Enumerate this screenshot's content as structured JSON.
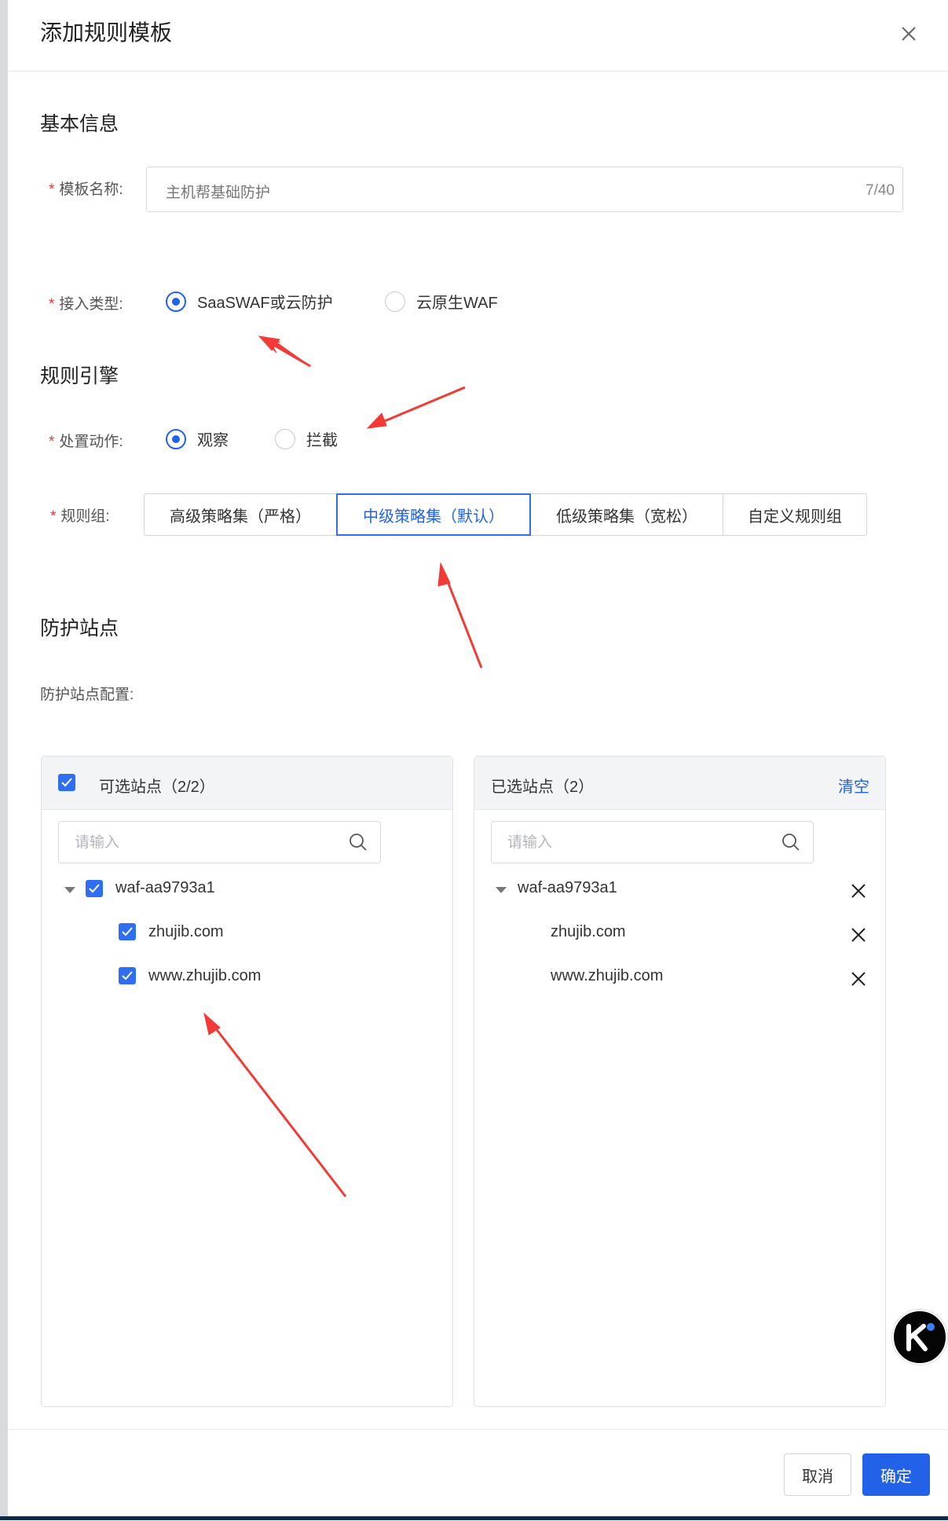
{
  "drawer": {
    "title": "添加规则模板"
  },
  "basic_info": {
    "section_title": "基本信息",
    "template_name": {
      "label": "模板名称:",
      "value": "主机帮基础防护",
      "counter": "7/40"
    },
    "access_type": {
      "label": "接入类型:",
      "options": [
        {
          "label": "SaaSWAF或云防护",
          "selected": true
        },
        {
          "label": "云原生WAF",
          "selected": false
        }
      ]
    }
  },
  "rule_engine": {
    "section_title": "规则引擎",
    "action": {
      "label": "处置动作:",
      "options": [
        {
          "label": "观察",
          "selected": true
        },
        {
          "label": "拦截",
          "selected": false
        }
      ]
    },
    "rule_group": {
      "label": "规则组:",
      "options": [
        {
          "label": "高级策略集（严格）",
          "selected": false
        },
        {
          "label": "中级策略集（默认）",
          "selected": true
        },
        {
          "label": "低级策略集（宽松）",
          "selected": false
        },
        {
          "label": "自定义规则组",
          "selected": false
        }
      ]
    }
  },
  "protect_sites": {
    "section_title": "防护站点",
    "config_label": "防护站点配置:",
    "available": {
      "title": "可选站点（2/2）",
      "search_placeholder": "请输入",
      "tree": {
        "group": "waf-aa9793a1",
        "children": [
          "zhujib.com",
          "www.zhujib.com"
        ]
      }
    },
    "selected": {
      "title": "已选站点（2）",
      "clear_label": "清空",
      "search_placeholder": "请输入",
      "tree": {
        "group": "waf-aa9793a1",
        "children": [
          "zhujib.com",
          "www.zhujib.com"
        ]
      }
    }
  },
  "footer": {
    "cancel": "取消",
    "confirm": "确定"
  },
  "colors": {
    "primary": "#2162e8",
    "required": "#e53935",
    "annotation": "#f23a36"
  },
  "icons": [
    "close-icon",
    "search-icon",
    "check-icon",
    "caret-down-icon",
    "remove-icon",
    "k-logo-icon"
  ]
}
